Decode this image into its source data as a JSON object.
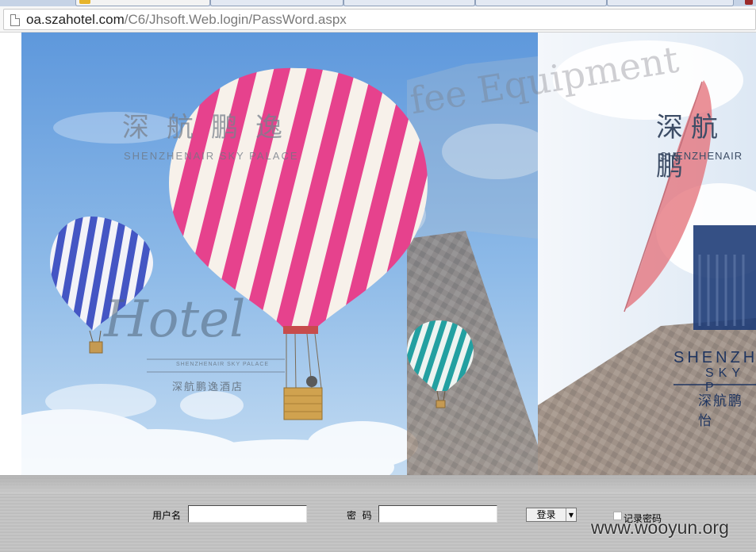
{
  "browser": {
    "url_host": "oa.szahotel.com",
    "url_path": "/C6/Jhsoft.Web.login/PassWord.aspx"
  },
  "banner": {
    "left_title": "深航鹏逸",
    "left_subtitle": "SHENZHENAIR SKY PALACE",
    "hotel_script": "Hotel",
    "hotel_sub": "SHENZHENAIR SKY PALACE",
    "hotel_cn": "深航鹏逸酒店",
    "overlay_text": "fee Equipment",
    "right_title": "深航鹏",
    "right_subtitle": "SHENZHENAIR",
    "right_card_line1": "SHENZH",
    "right_card_line2": "SKY P",
    "right_card_cn": "深航鹏怡"
  },
  "login": {
    "username_label": "用户名",
    "username_value": "",
    "password_label": "密  码",
    "password_value": "",
    "login_button": "登录",
    "remember_label": "记录密码"
  },
  "watermark": "www.wooyun.org",
  "colors": {
    "sky": "#6fa3df",
    "balloon_pink": "#e8438f",
    "balloon_blue": "#4a5fc9",
    "balloon_teal": "#27a3a5"
  }
}
